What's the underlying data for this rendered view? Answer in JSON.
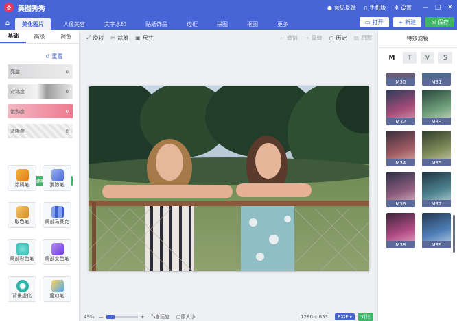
{
  "app": {
    "name": "美图秀秀",
    "logo_icon": "logo-icon"
  },
  "titlebar": {
    "feedback": "意见反馈",
    "mobile": "手机版",
    "settings": "设置",
    "minimize": "—",
    "maximize": "□",
    "close": "✕"
  },
  "nav": {
    "home_icon": "home-icon",
    "tabs": [
      "美化图片",
      "人像美容",
      "文字水印",
      "贴纸饰品",
      "边框",
      "拼图",
      "抠图",
      "更多"
    ],
    "open": "打开",
    "new": "新建",
    "save": "保存"
  },
  "left": {
    "subtabs": [
      "基础",
      "高级",
      "调色"
    ],
    "reset": "重置",
    "sliders": [
      {
        "label": "亮度",
        "value": "0"
      },
      {
        "label": "对比度",
        "value": "0"
      },
      {
        "label": "饱和度",
        "value": "0"
      },
      {
        "label": "清晰度",
        "value": "0"
      }
    ],
    "oneclick": "一键美化",
    "tools": [
      "涂鸦笔",
      "消除笔",
      "取色笔",
      "局部马赛克",
      "局部彩色笔",
      "局部变色笔",
      "背景虚化",
      "魔幻笔"
    ]
  },
  "toolbar": {
    "rotate": "旋转",
    "crop": "裁剪",
    "size": "尺寸",
    "undo": "撤销",
    "redo": "重做",
    "history": "历史",
    "original": "原图"
  },
  "right": {
    "title": "特效滤镜",
    "filter_tabs": [
      "M",
      "T",
      "V",
      "S"
    ],
    "filters": [
      "M30",
      "M31",
      "M32",
      "M33",
      "M34",
      "M35",
      "M36",
      "M37",
      "M38",
      "M39"
    ]
  },
  "status": {
    "zoom": "49%",
    "zoom_minus": "—",
    "zoom_plus": "+",
    "fit": "自适应",
    "actual": "原大小",
    "dimensions": "1280 x 853",
    "exif": "EXIF ▾",
    "compare": "对比"
  },
  "colors": {
    "primary": "#4765d6",
    "save_green": "#3fb56a",
    "saturation_pink": "#ee7a90"
  }
}
